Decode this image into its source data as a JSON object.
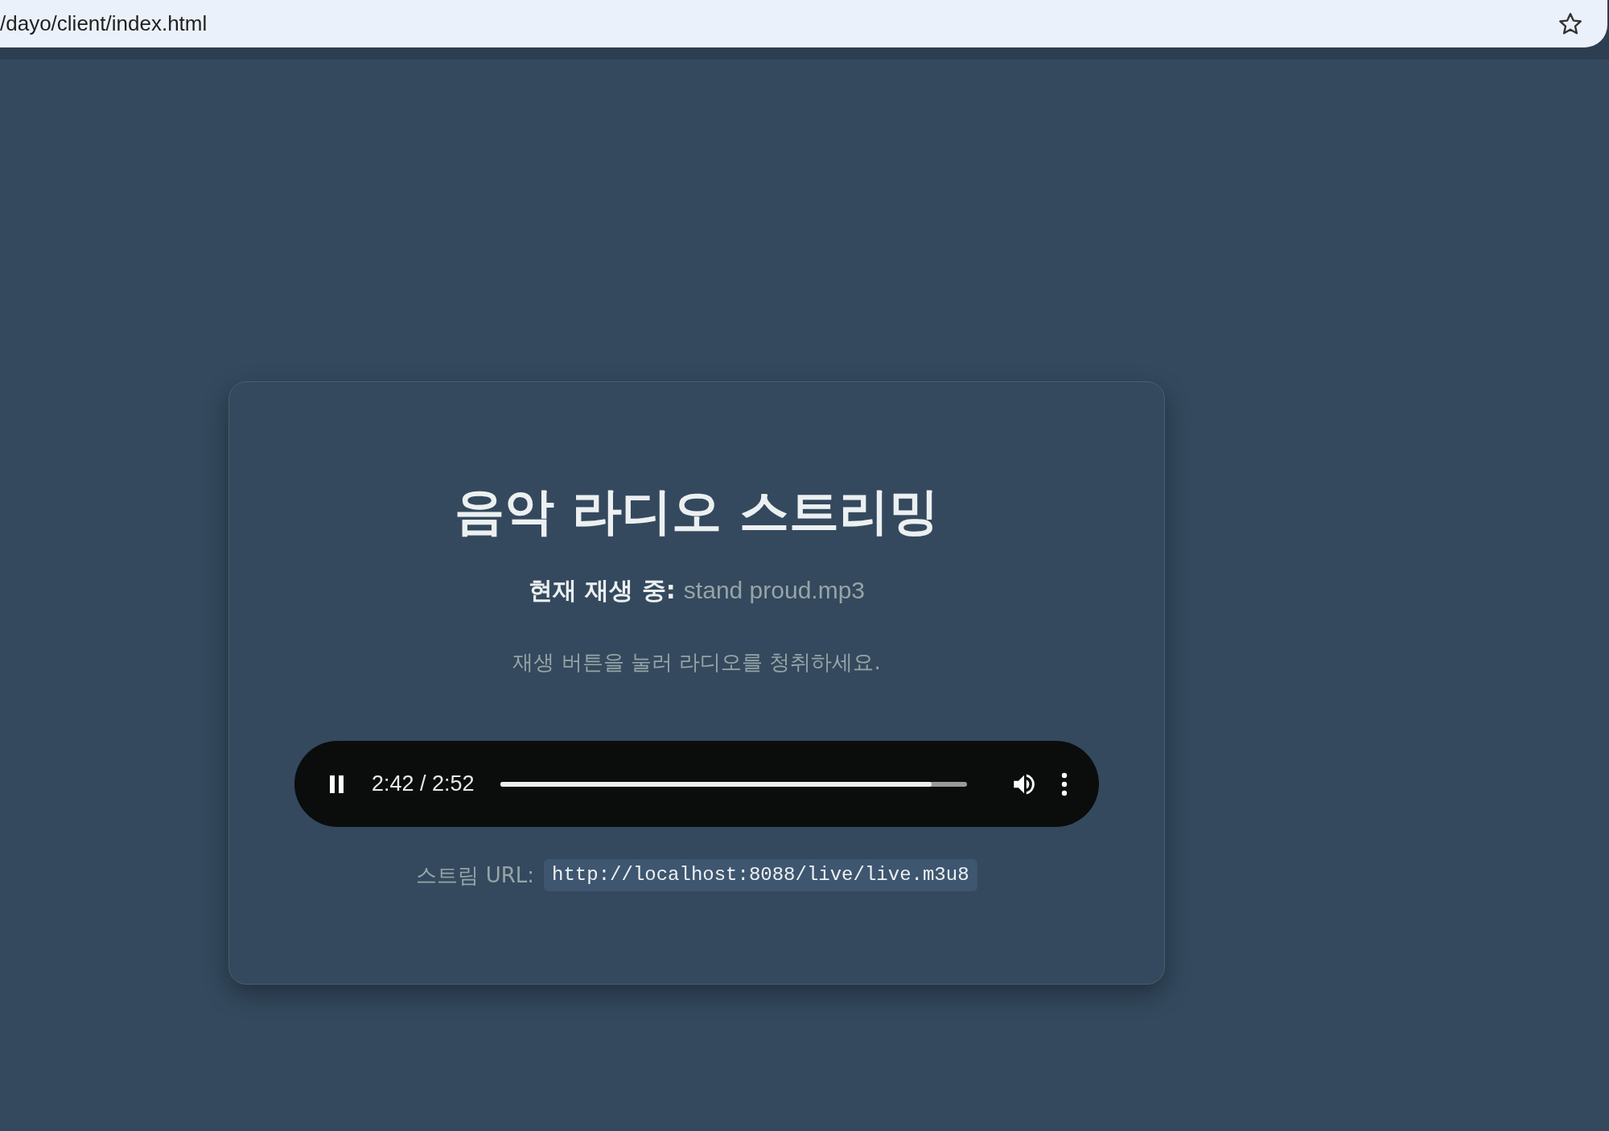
{
  "address_bar": {
    "url": "/dayo/client/index.html"
  },
  "card": {
    "title": "음악 라디오 스트리밍",
    "now_playing": {
      "label": "현재 재생 중:",
      "track": "stand proud.mp3"
    },
    "hint": "재생 버튼을 눌러 라디오를 청취하세요.",
    "player": {
      "playing": true,
      "time": "2:42 / 2:52",
      "level": 0.925
    },
    "stream": {
      "label": "스트림 URL:",
      "url": "http://localhost:8088/live/live.m3u8"
    }
  }
}
